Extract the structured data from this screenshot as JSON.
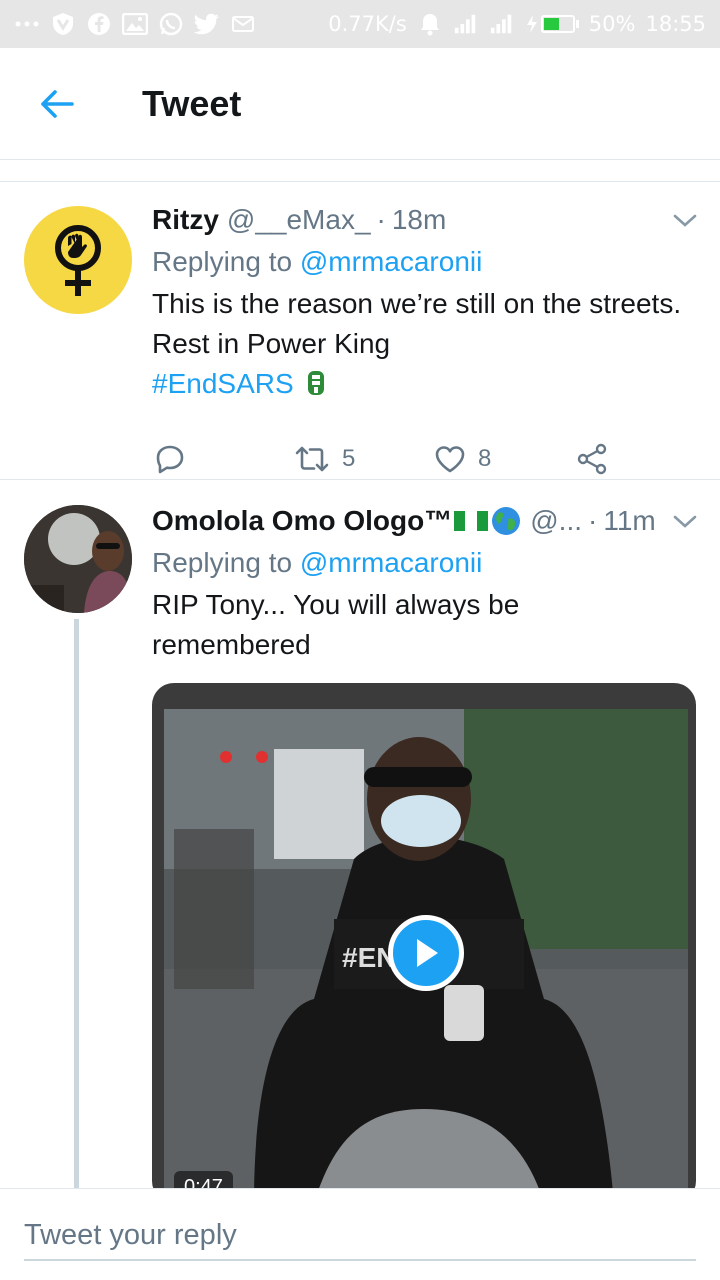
{
  "status_bar": {
    "network_speed": "0.77K/s",
    "battery_percent": "50%",
    "time": "18:55",
    "icons": [
      "more-dots-icon",
      "vpn-icon",
      "facebook-icon",
      "gallery-icon",
      "whatsapp-icon",
      "twitter-icon",
      "mail-icon",
      "alarm-icon",
      "signal-icon",
      "signal-h-icon",
      "battery-icon"
    ]
  },
  "header": {
    "title": "Tweet",
    "back_icon": "arrow-left-icon"
  },
  "tweets": [
    {
      "name": "Ritzy",
      "handle": "@__eMax_",
      "separator": "·",
      "time": "18m",
      "replying_label": "Replying to",
      "replying_to": "@mrmacaronii",
      "text": "This is the reason we’re still on the streets. Rest in Power King",
      "hashtag": "#EndSARS",
      "avatar": "feminist-fist-icon",
      "actions": {
        "reply": "",
        "retweets": "5",
        "likes": "8"
      }
    },
    {
      "name": "Omolola Omo Ologo™",
      "handle": "@...",
      "separator": "·",
      "time": "11m",
      "replying_label": "Replying to",
      "replying_to": "@mrmacaronii",
      "text": "RIP Tony... You will always be remembered",
      "media": {
        "type": "video",
        "duration": "0:47"
      }
    }
  ],
  "reply_bar": {
    "placeholder": "Tweet your reply"
  },
  "colors": {
    "accent": "#1da1f2",
    "muted": "#657786",
    "border": "#e1e8ed",
    "avatar_yellow": "#f6d744"
  }
}
